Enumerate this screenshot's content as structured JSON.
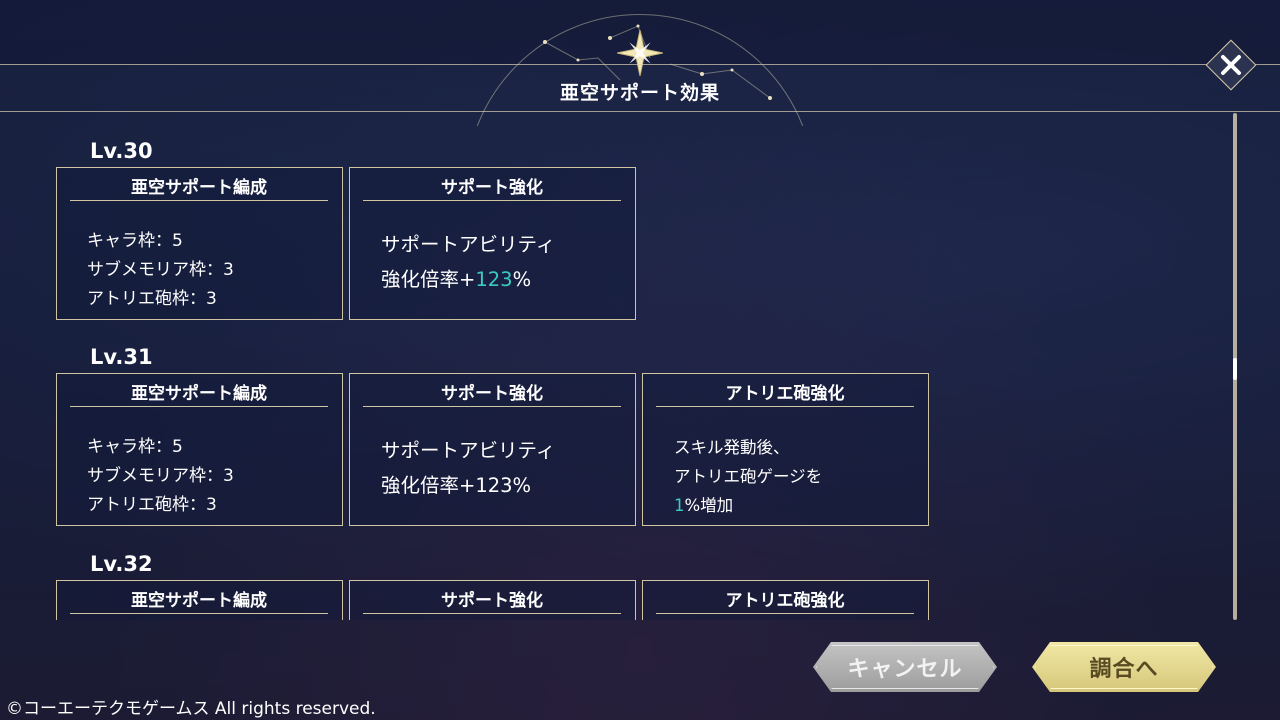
{
  "dialog": {
    "title": "亜空サポート効果",
    "close_label": "✕"
  },
  "levels": [
    {
      "level": "Lv.30",
      "cards": [
        {
          "header": "亜空サポート編成",
          "lines": [
            "キャラ枠：5",
            "サブメモリア枠：3",
            "アトリエ砲枠：3"
          ]
        },
        {
          "header": "サポート強化",
          "line1": "サポートアビリティ",
          "line2_prefix": "強化倍率+",
          "line2_value": "123",
          "line2_suffix": "%"
        }
      ]
    },
    {
      "level": "Lv.31",
      "cards": [
        {
          "header": "亜空サポート編成",
          "lines": [
            "キャラ枠：5",
            "サブメモリア枠：3",
            "アトリエ砲枠：3"
          ]
        },
        {
          "header": "サポート強化",
          "line1": "サポートアビリティ",
          "line2": "強化倍率+123%"
        },
        {
          "header": "アトリエ砲強化",
          "lines": [
            "スキル発動後、",
            "アトリエ砲ゲージを"
          ],
          "line3_value": "1",
          "line3_suffix": "%増加"
        }
      ]
    },
    {
      "level": "Lv.32",
      "cards": [
        {
          "header": "亜空サポート編成"
        },
        {
          "header": "サポート強化"
        },
        {
          "header": "アトリエ砲強化"
        }
      ]
    }
  ],
  "buttons": {
    "cancel": "キャンセル",
    "confirm": "調合へ"
  },
  "footer": {
    "copyright": "©コーエーテクモゲームス All rights reserved."
  },
  "colors": {
    "accent_teal": "#3cc9c3",
    "frame_gold": "#cfc5a0"
  },
  "icons": {
    "close": "close-icon",
    "emblem": "star-emblem-icon"
  }
}
